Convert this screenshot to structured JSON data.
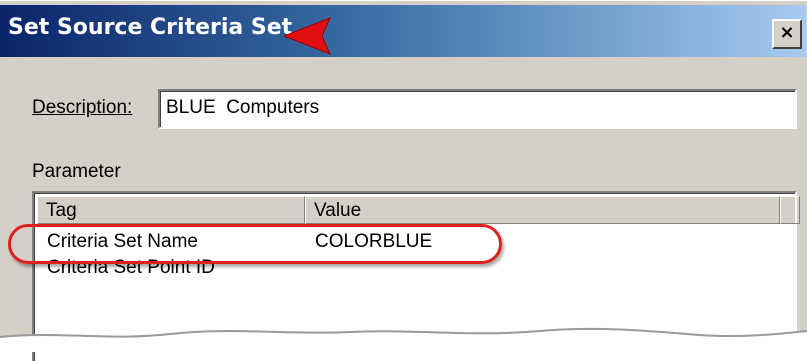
{
  "window": {
    "title": "Set Source Criteria Set",
    "close_glyph": "×"
  },
  "form": {
    "description_label": "Description:",
    "description_value": "BLUE  Computers",
    "parameter_label": "Parameter"
  },
  "table": {
    "columns": [
      "Tag",
      "Value"
    ],
    "rows": [
      {
        "tag": "Criteria Set Name",
        "value": "COLORBLUE"
      },
      {
        "tag": "Criteria Set Point ID",
        "value": ""
      }
    ]
  },
  "annotations": {
    "arrow_color": "#e01010",
    "highlight_color": "#e02020"
  },
  "colors": {
    "titlebar_start": "#0a246a",
    "titlebar_end": "#a6caf0",
    "dialog_face": "#d4d0c8"
  }
}
